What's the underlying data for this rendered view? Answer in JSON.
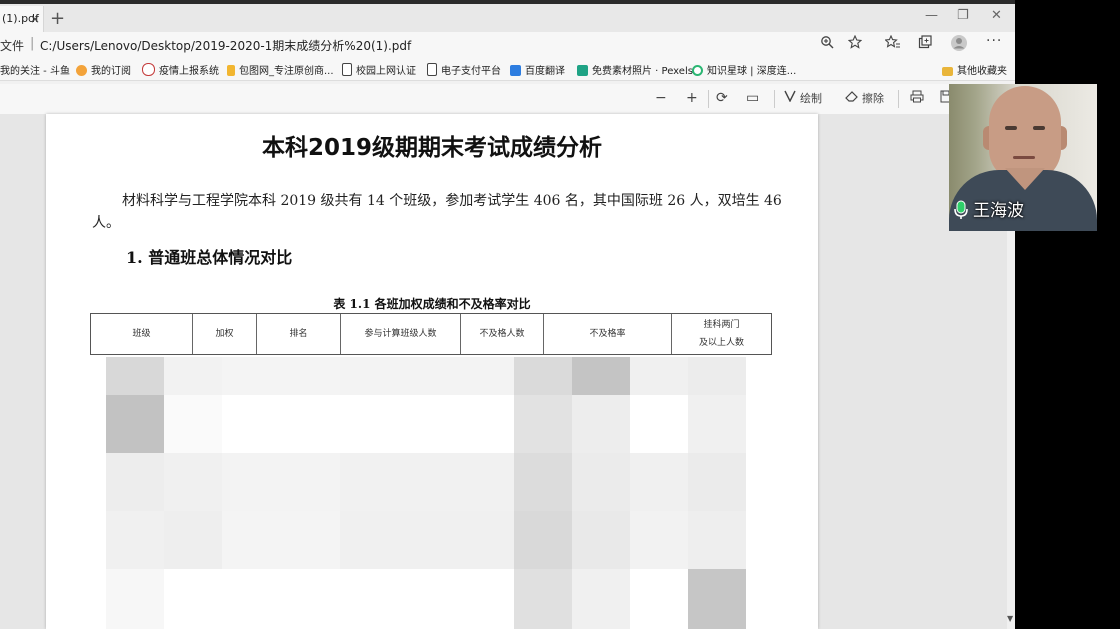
{
  "browser": {
    "tab_title": "(1).pdf",
    "tab_close": "×",
    "new_tab": "+",
    "window_controls": {
      "minimize": "—",
      "maximize": "❐",
      "close": "✕"
    }
  },
  "address": {
    "label": "文件",
    "separator": "|",
    "url": "C:/Users/Lenovo/Desktop/2019-2020-1期末成绩分析%20(1).pdf"
  },
  "favorites": [
    {
      "label": "我的关注 - 斗鱼",
      "icon": "douyu-icon",
      "color": "#f08a24"
    },
    {
      "label": "我的订阅",
      "icon": "subscribe-icon",
      "color": "#f3a33a"
    },
    {
      "label": "疫情上报系统",
      "icon": "report-icon",
      "color": "#c43a3a"
    },
    {
      "label": "包图网_专注原创商...",
      "icon": "baotu-icon",
      "color": "#f2b630"
    },
    {
      "label": "校园上网认证",
      "icon": "page-icon",
      "color": "#ffffff"
    },
    {
      "label": "电子支付平台",
      "icon": "page-icon",
      "color": "#ffffff"
    },
    {
      "label": "百度翻译",
      "icon": "translate-icon",
      "color": "#2d7de0"
    },
    {
      "label": "免费素材照片 · Pexels",
      "icon": "pexels-icon",
      "color": "#1fa385"
    },
    {
      "label": "知识星球 | 深度连...",
      "icon": "planet-icon",
      "color": "#2bb673"
    },
    {
      "label": "其他收藏夹",
      "icon": "folder-icon",
      "color": "#e9b53a"
    }
  ],
  "pdf_toolbar": {
    "zoom_out": "−",
    "zoom_in": "+",
    "rotate": "⟳",
    "fit": "▭",
    "draw_label": "绘制",
    "erase_label": "擦除"
  },
  "document": {
    "title": "本科2019级期期末考试成绩分析",
    "paragraph": "材料科学与工程学院本科 2019 级共有 14 个班级，参加考试学生 406 名，其中国际班 26 人，双培生 46 人。",
    "heading1": "1. 普通班总体情况对比",
    "table_caption": "表 1.1 各班加权成绩和不及格率对比",
    "table_headers": [
      "班级",
      "加权",
      "排名",
      "参与计算班级人数",
      "不及格人数",
      "不及格率",
      "挂科两门\n及以上人数"
    ]
  },
  "webcam": {
    "participant_name": "王海波"
  }
}
